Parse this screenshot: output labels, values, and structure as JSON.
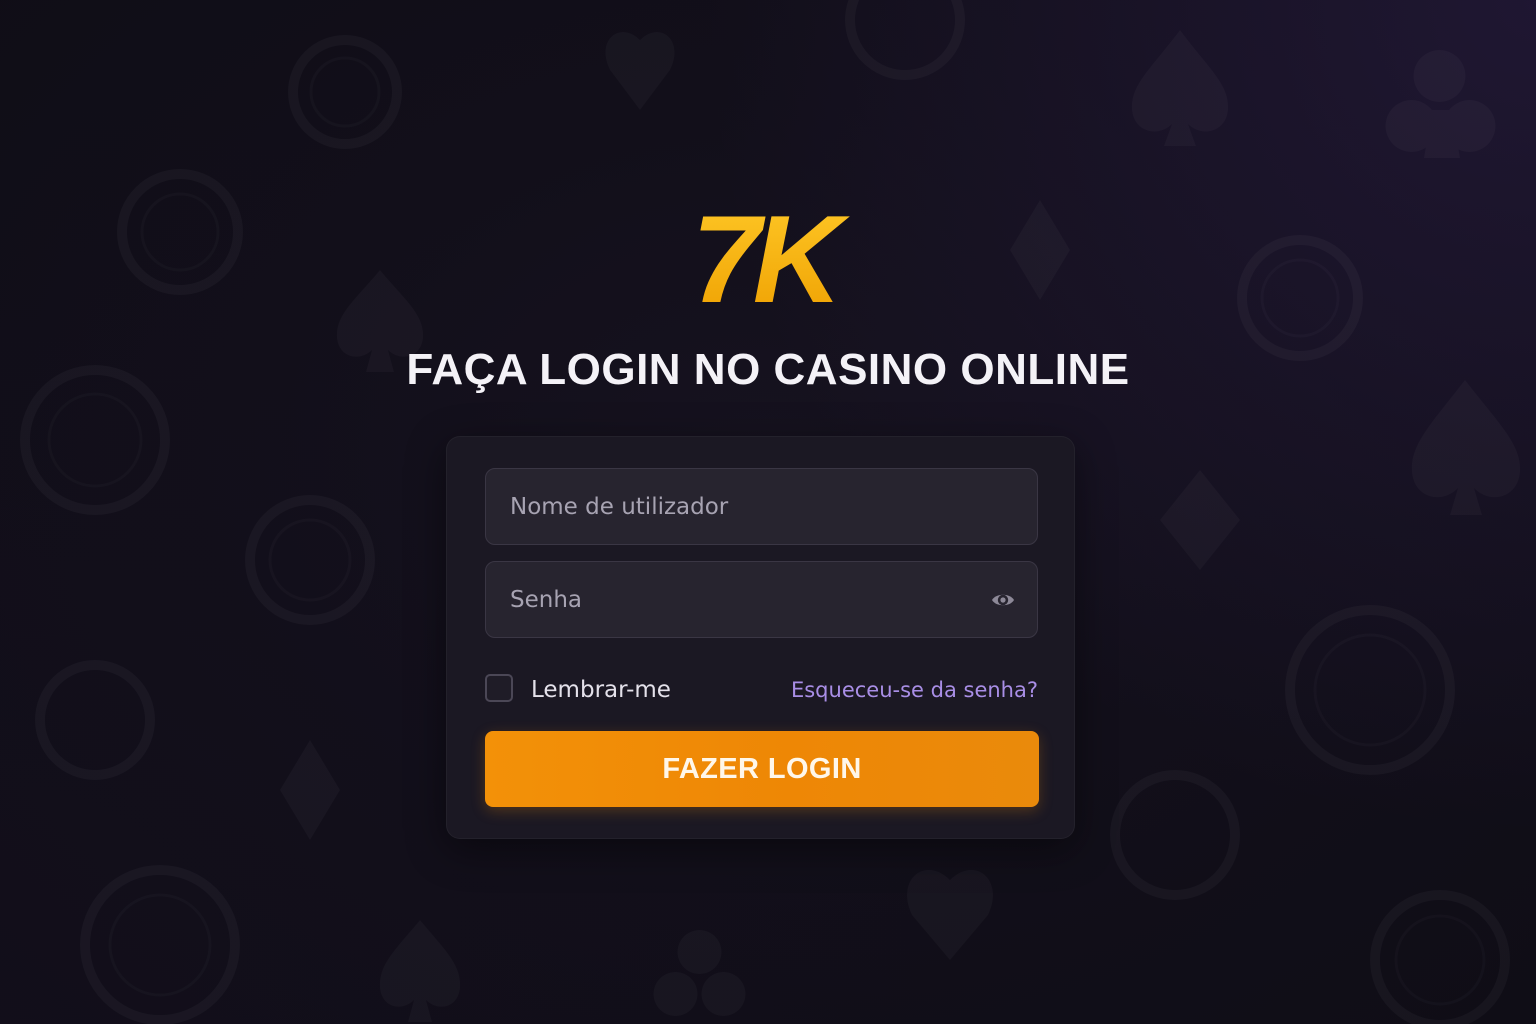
{
  "brand": {
    "logo_text": "7K",
    "colors": {
      "logo_gradient_top": "#ffc21a",
      "logo_gradient_bottom": "#f0a300",
      "accent_button": "#f18c06",
      "link": "#a98ee6",
      "background": "#120f1a",
      "card": "#1c1924",
      "input": "#27242f"
    }
  },
  "header": {
    "title": "FAÇA LOGIN NO CASINO ONLINE"
  },
  "form": {
    "username": {
      "placeholder": "Nome de utilizador",
      "value": ""
    },
    "password": {
      "placeholder": "Senha",
      "value": "",
      "toggle_icon": "eye-icon"
    },
    "remember": {
      "label": "Lembrar-me",
      "checked": false
    },
    "forgot_link": "Esqueceu-se da senha?",
    "submit_label": "FAZER LOGIN"
  },
  "background": {
    "decor_icons": [
      "poker-chip-icon",
      "spade-icon",
      "club-icon",
      "diamond-icon",
      "heart-icon"
    ]
  }
}
